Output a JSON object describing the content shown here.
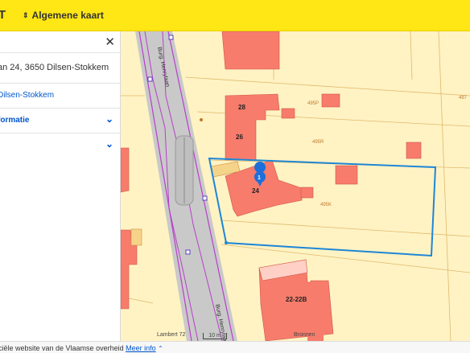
{
  "header": {
    "brand": "T",
    "map_button": "Algemene kaart"
  },
  "panel": {
    "address": "an 24, 3650 Dilsen-Stokkem",
    "municipality_link": "Dilsen-Stokkem",
    "accordions": [
      {
        "label": "formatie"
      },
      {
        "label": ""
      }
    ]
  },
  "map": {
    "street_labels": [
      "Burg. Henrylaan",
      "Burg. Henrylaan"
    ],
    "building_labels": [
      "28",
      "26",
      "24",
      "22-22B"
    ],
    "parcel_labels": [
      "495P",
      "495R",
      "495K",
      "497"
    ],
    "marker_number": "1",
    "scale": {
      "crs": "Lambert 72",
      "distance": "10 m",
      "sources": "Bronnen"
    },
    "colors": {
      "parcel": "#fff3c4",
      "building": "#f77c6c",
      "road": "#c9c9c9",
      "selection": "#1e86d6",
      "marker": "#1e6fd9"
    }
  },
  "footer": {
    "text": "ciële website van de Vlaamse overheid",
    "link": "Meer info"
  }
}
